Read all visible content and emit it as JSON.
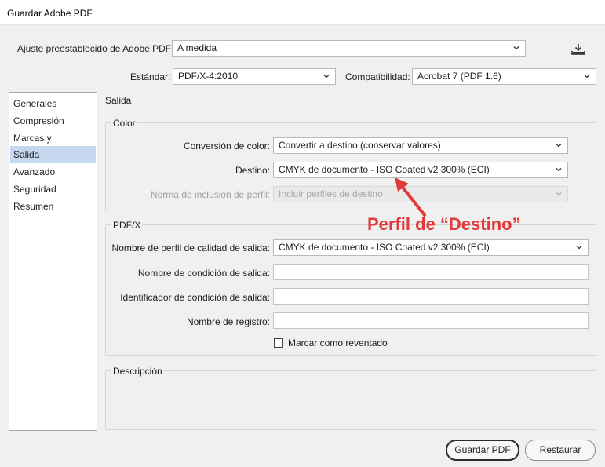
{
  "window": {
    "title": "Guardar Adobe PDF"
  },
  "preset": {
    "label": "Ajuste preestablecido de Adobe PDF:",
    "value": "A medida"
  },
  "standard": {
    "label": "Estándar:",
    "value": "PDF/X-4:2010"
  },
  "compat": {
    "label": "Compatibilidad:",
    "value": "Acrobat 7 (PDF 1.6)"
  },
  "sidebar": {
    "items": [
      {
        "label": "Generales"
      },
      {
        "label": "Compresión"
      },
      {
        "label": "Marcas y sangrados"
      },
      {
        "label": "Salida"
      },
      {
        "label": "Avanzado"
      },
      {
        "label": "Seguridad"
      },
      {
        "label": "Resumen"
      }
    ],
    "active": "Salida"
  },
  "section": {
    "title": "Salida"
  },
  "color_group": {
    "title": "Color",
    "conversion": {
      "label": "Conversión de color:",
      "value": "Convertir a destino (conservar valores)"
    },
    "destino": {
      "label": "Destino:",
      "value": "CMYK de documento - ISO Coated v2 300% (ECI)"
    },
    "inclusion": {
      "label": "Norma de inclusión de perfil:",
      "value": "Incluir perfiles de destino"
    }
  },
  "pdfx_group": {
    "title": "PDF/X",
    "profile_name": {
      "label": "Nombre de perfil de calidad de salida:",
      "value": "CMYK de documento - ISO Coated v2 300% (ECI)"
    },
    "condition_name": {
      "label": "Nombre de condición de salida:",
      "value": ""
    },
    "condition_id": {
      "label": "Identificador de condición de salida:",
      "value": ""
    },
    "registry": {
      "label": "Nombre de registro:",
      "value": ""
    },
    "trapped": {
      "label": "Marcar como reventado",
      "checked": false
    }
  },
  "description_group": {
    "title": "Descripción"
  },
  "buttons": {
    "save": "Guardar PDF",
    "reset": "Restaurar"
  },
  "annotation": {
    "text": "Perfil de “Destino”",
    "color": "#e03a3a"
  }
}
